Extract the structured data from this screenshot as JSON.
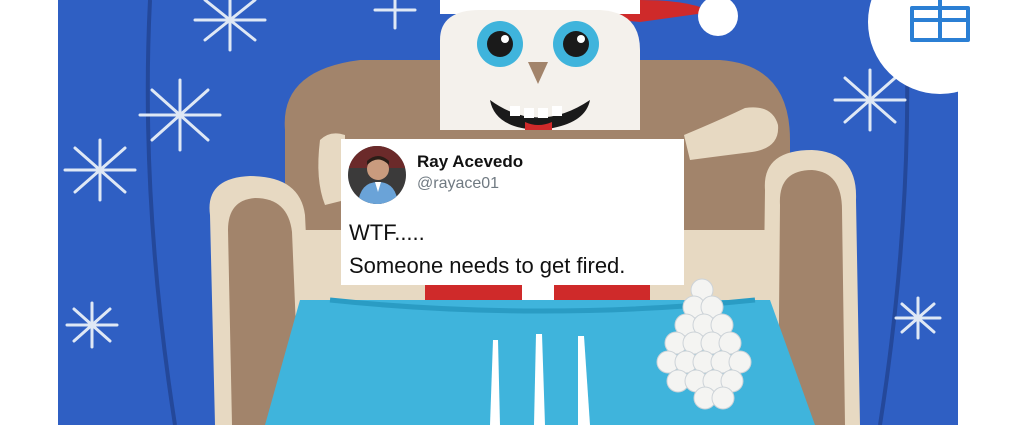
{
  "tweet": {
    "display_name": "Ray Acevedo",
    "handle": "@rayace01",
    "text_lines": [
      "WTF.....",
      "Someone needs to get fired."
    ]
  },
  "icons": {
    "gift": "gift-icon",
    "avatar": "avatar"
  },
  "colors": {
    "sweater_blue": "#2f5fc3",
    "sky_blue_table": "#3fb4dc",
    "santa_red": "#cf2a2a",
    "chair_brown": "#a2846b",
    "gift_icon": "#2b7fd4"
  }
}
